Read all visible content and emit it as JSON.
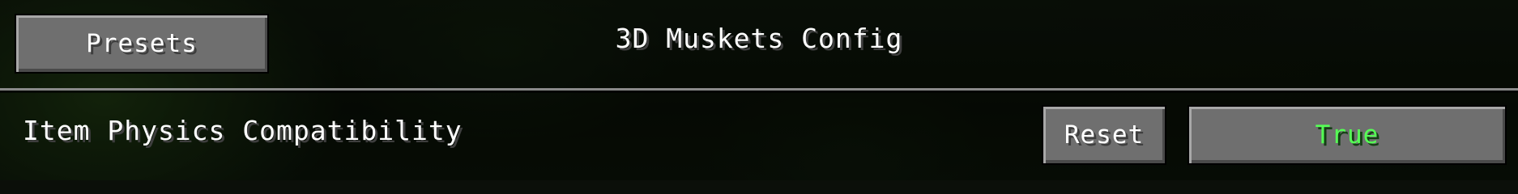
{
  "header": {
    "presets_label": "Presets",
    "title": "3D Muskets Config"
  },
  "options": [
    {
      "label": "Item Physics Compatibility",
      "reset_label": "Reset",
      "value": "True",
      "value_color": "#55ff55"
    }
  ]
}
